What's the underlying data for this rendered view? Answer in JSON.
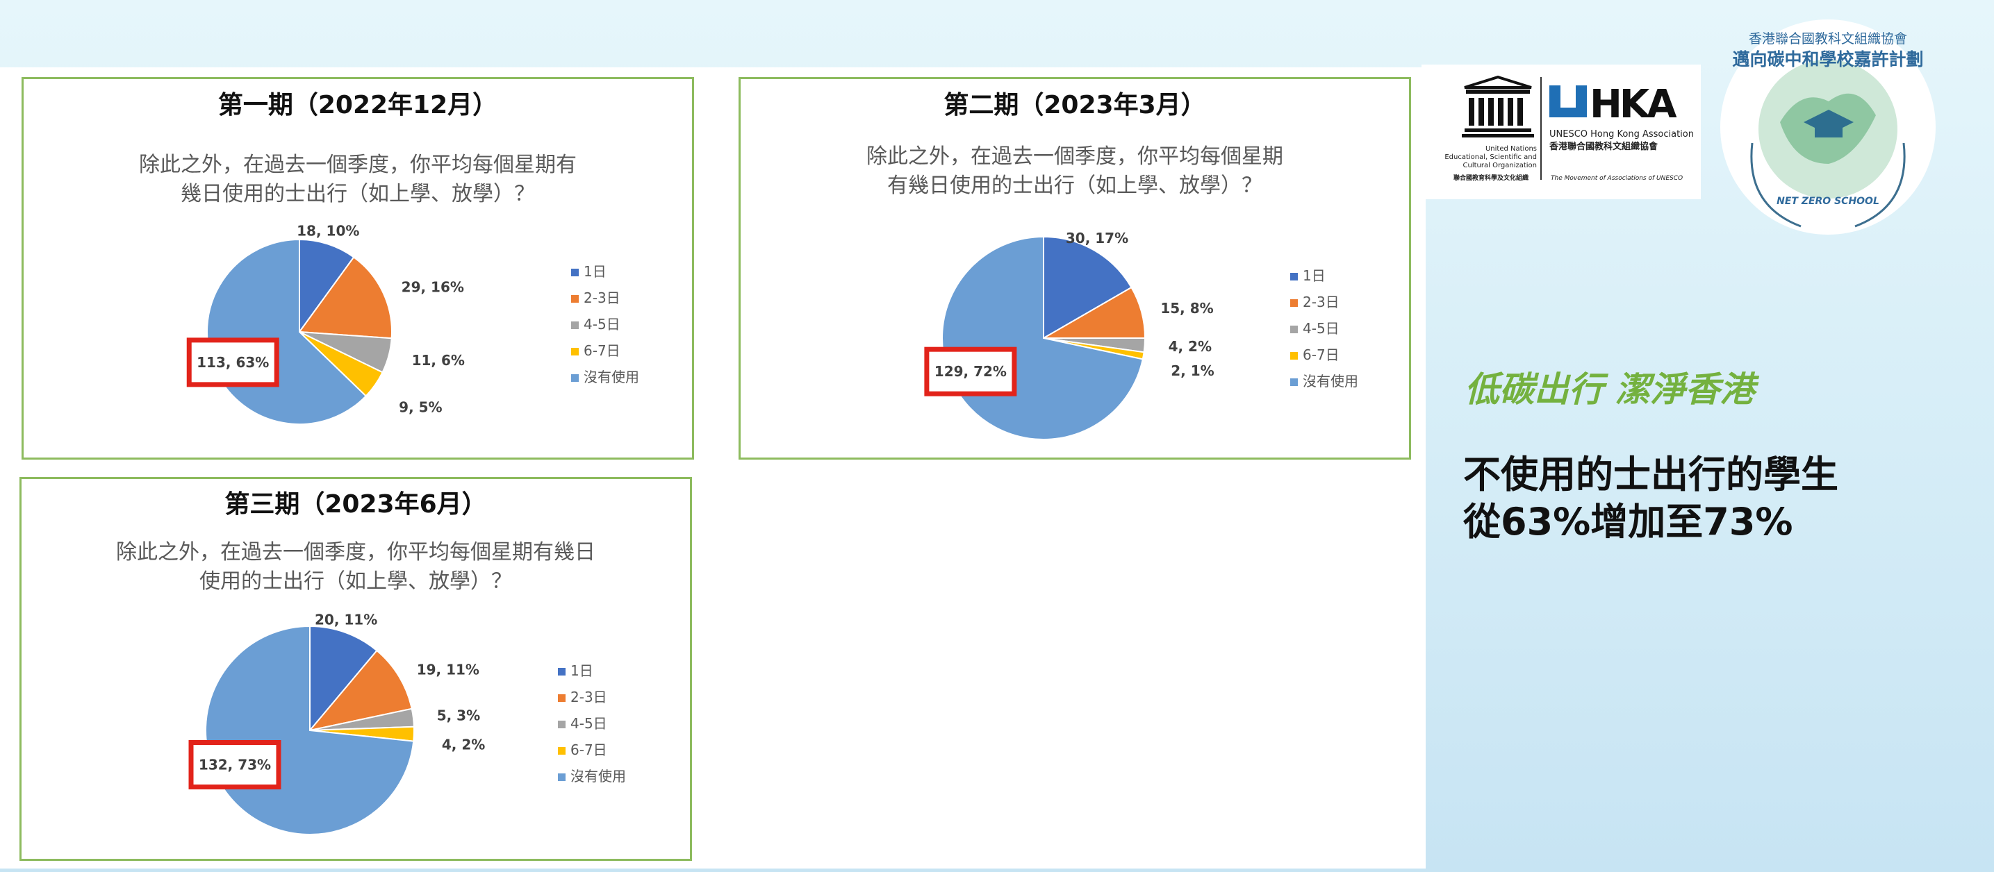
{
  "colors": {
    "c1": "#4472c4",
    "c2": "#ed7d31",
    "c3": "#a5a5a5",
    "c4": "#ffc000",
    "c5": "#6b9ed4",
    "highlight": "#e2231a",
    "border": "#8dbb5e",
    "slogan": "#74b13f"
  },
  "legend": [
    "1日",
    "2-3日",
    "4-5日",
    "6-7日",
    "沒有使用"
  ],
  "chart_data": [
    {
      "type": "pie",
      "title": "第一期（2022年12月）",
      "question_line1": "除此之外，在過去一個季度，你平均每個星期有",
      "question_line2": "幾日使用的士出行（如上學、放學）？",
      "categories": [
        "1日",
        "2-3日",
        "4-5日",
        "6-7日",
        "沒有使用"
      ],
      "values": [
        18,
        29,
        11,
        9,
        113
      ],
      "labels": [
        "18, 10%",
        "29, 16%",
        "11, 6%",
        "9, 5%",
        "113, 63%"
      ]
    },
    {
      "type": "pie",
      "title": "第二期（2023年3月）",
      "question_line1": "除此之外，在過去一個季度，你平均每個星期",
      "question_line2": "有幾日使用的士出行（如上學、放學）？",
      "categories": [
        "1日",
        "2-3日",
        "4-5日",
        "6-7日",
        "沒有使用"
      ],
      "values": [
        30,
        15,
        4,
        2,
        129
      ],
      "labels": [
        "30, 17%",
        "15, 8%",
        "4, 2%",
        "2, 1%",
        "129, 72%"
      ]
    },
    {
      "type": "pie",
      "title": "第三期（2023年6月）",
      "question_line1": "除此之外，在過去一個季度，你平均每個星期有幾日",
      "question_line2": "使用的士出行（如上學、放學）？",
      "categories": [
        "1日",
        "2-3日",
        "4-5日",
        "6-7日",
        "沒有使用"
      ],
      "values": [
        20,
        19,
        5,
        4,
        132
      ],
      "labels": [
        "20, 11%",
        "19, 11%",
        "5, 3%",
        "4, 2%",
        "132, 73%"
      ]
    }
  ],
  "logos": {
    "unesco_line1": "United Nations",
    "unesco_line2": "Educational, Scientific and",
    "unesco_line3": "Cultural Organization",
    "unesco_cn": "聯合國教育科學及文化組織",
    "uhka_en": "UNESCO Hong Kong Association",
    "uhka_cn": "香港聯合國教科文組織協會",
    "uhka_tag": "The Movement of Associations of UNESCO",
    "seal_top": "香港聯合國教科文組織協會",
    "seal_mid": "邁向碳中和學校嘉許計劃",
    "seal_bottom": "NET ZERO SCHOOL"
  },
  "slogan": "低碳出行 潔淨香港",
  "conclusion_line1": "不使用的士出行的學生",
  "conclusion_line2": "從63%增加至73%"
}
